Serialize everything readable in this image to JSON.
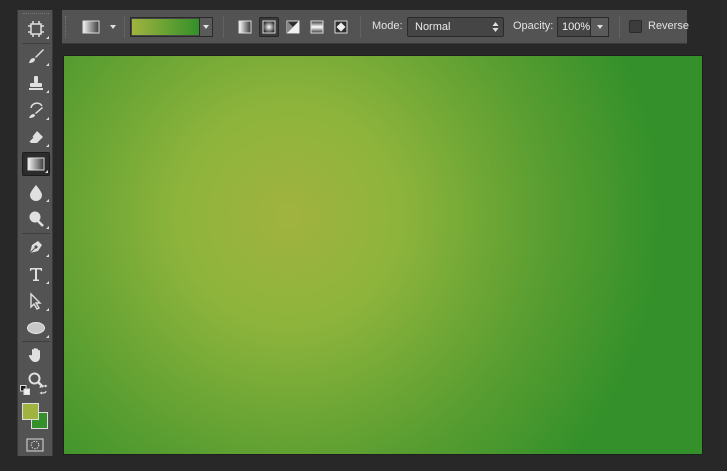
{
  "colors": {
    "foreground": "#a1b33f",
    "background": "#33902a",
    "panel": "#535353",
    "workspace": "#282828"
  },
  "tools": [
    {
      "name": "artboard-tool-button",
      "icon": "move-artboard-icon",
      "active": false
    },
    {
      "name": "brush-tool-button",
      "icon": "brush-icon",
      "active": false
    },
    {
      "name": "clone-stamp-tool-button",
      "icon": "stamp-icon",
      "active": false
    },
    {
      "name": "history-brush-tool-button",
      "icon": "history-brush-icon",
      "active": false
    },
    {
      "name": "eraser-tool-button",
      "icon": "eraser-icon",
      "active": false
    },
    {
      "name": "gradient-tool-button",
      "icon": "gradient-icon",
      "active": true
    },
    {
      "name": "blur-tool-button",
      "icon": "drop-icon",
      "active": false
    },
    {
      "name": "dodge-tool-button",
      "icon": "dodge-icon",
      "active": false
    },
    {
      "name": "pen-tool-button",
      "icon": "pen-icon",
      "active": false
    },
    {
      "name": "type-tool-button",
      "icon": "type-icon",
      "active": false
    },
    {
      "name": "path-selection-tool-button",
      "icon": "arrow-icon",
      "active": false
    },
    {
      "name": "ellipse-tool-button",
      "icon": "ellipse-icon",
      "active": false
    },
    {
      "name": "hand-tool-button",
      "icon": "hand-icon",
      "active": false
    },
    {
      "name": "zoom-tool-button",
      "icon": "zoom-icon",
      "active": false
    }
  ],
  "options": {
    "gradient_types": [
      "linear",
      "radial",
      "angle",
      "reflected",
      "diamond"
    ],
    "active_gradient_type": "radial",
    "mode_label": "Mode:",
    "mode_value": "Normal",
    "opacity_label": "Opacity:",
    "opacity_value": "100%",
    "reverse_label": "Reverse",
    "reverse_checked": false
  }
}
